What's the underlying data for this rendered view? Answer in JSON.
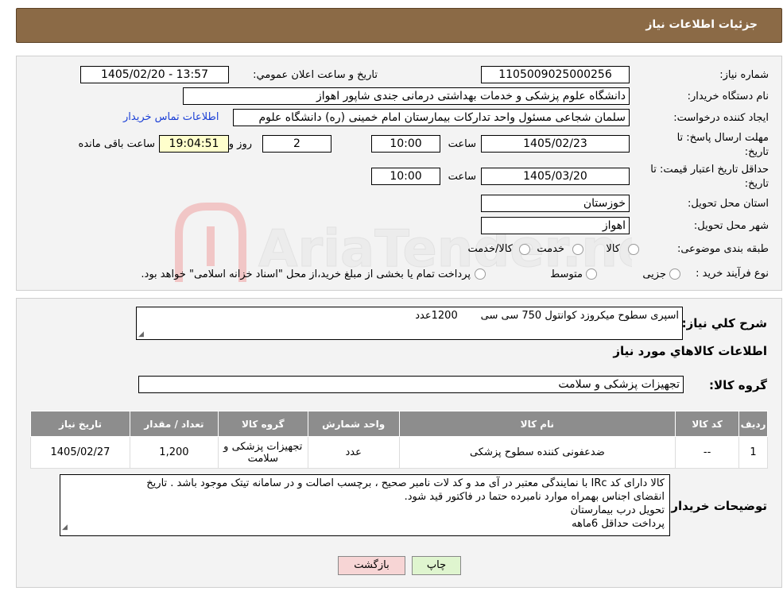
{
  "header": {
    "title": "جزئیات اطلاعات نیاز"
  },
  "form": {
    "need_number": {
      "label": "شماره نیاز:",
      "value": "1105009025000256"
    },
    "announce_datetime": {
      "label": "تاریخ و ساعت اعلان عمومي:",
      "value": "1405/02/20 - 13:57"
    },
    "buyer_org": {
      "label": "نام دستگاه خريدار:",
      "value": "دانشگاه علوم پزشکی و خدمات بهداشتی درمانی جندی شاپور اهواز"
    },
    "requester": {
      "label": "ایجاد کننده درخواست:",
      "value": "سلمان شجاعی مسئول واحد تداركات بيمارستان امام خمینی (ره) دانشگاه علوم",
      "contact_link": "اطلاعات تماس خریدار"
    },
    "deadline": {
      "label_line1": "مهلت ارسال پاسخ: تا",
      "label_line2": "تاریخ:",
      "date": "1405/02/23",
      "time_label": "ساعت",
      "time": "10:00",
      "days": "2",
      "days_label": "روز و",
      "remaining": "19:04:51",
      "remaining_label": "ساعت باقی مانده"
    },
    "validity": {
      "label_line1": "حداقل تاریخ اعتبار قیمت: تا",
      "label_line2": "تاریخ:",
      "date": "1405/03/20",
      "time_label": "ساعت",
      "time": "10:00"
    },
    "province": {
      "label": "استان محل تحویل:",
      "value": "خوزستان"
    },
    "city": {
      "label": "شهر محل تحویل:",
      "value": "اهواز"
    },
    "category": {
      "label": "طبقه بندی موضوعی:",
      "options": [
        "کالا",
        "خدمت",
        "کالا/خدمت"
      ]
    },
    "purchase_type": {
      "label": "نوع فرآیند خرید :",
      "options": [
        "جزیی",
        "متوسط"
      ],
      "note": "پرداخت تمام یا بخشی از مبلغ خرید،از محل \"اسناد خزانه اسلامی\" خواهد بود."
    }
  },
  "description": {
    "label": "شرح کلي نياز:",
    "value": "اسپری سطوح میکروزد کوانتول 750 سی سی       1200عدد"
  },
  "items_title": "اطلاعات کالاهاي مورد نياز",
  "goods_group": {
    "label": "گروه کالا:",
    "value": "تجهیزات پزشکی و سلامت"
  },
  "table": {
    "headers": [
      "رديف",
      "کد کالا",
      "نام کالا",
      "واحد شمارش",
      "گروه کالا",
      "تعداد / مقدار",
      "تاریخ نیاز"
    ],
    "rows": [
      [
        "1",
        "--",
        "ضدعفونی کننده سطوح پزشکی",
        "عدد",
        "تجهیزات پزشکی و سلامت",
        "1,200",
        "1405/02/27"
      ]
    ]
  },
  "buyer_notes": {
    "label": "توضیحات خریدار:",
    "lines": [
      "کالا دارای کد IRc با نمایندگی معتبر در آی مد و کد لات نامبر صحیح ، برچسب اصالت و در سامانه تیتک موجود باشد . تاریخ",
      "انقضای اجناس بهمراه موارد نامبرده حتما در فاکتور قید شود.",
      "تحویل درب بیمارستان",
      "پرداخت حداقل 6ماهه"
    ]
  },
  "buttons": {
    "print": "چاپ",
    "back": "بازگشت"
  },
  "watermark": {
    "text": "AriaTender.neT"
  },
  "colors": {
    "header_bg": "#8b6a46",
    "table_header_bg": "#8d8d8d",
    "link": "#1a3fd6",
    "print_btn": "#dff5cf",
    "back_btn": "#f7d5d5",
    "remaining_bg": "#ffffcc"
  }
}
